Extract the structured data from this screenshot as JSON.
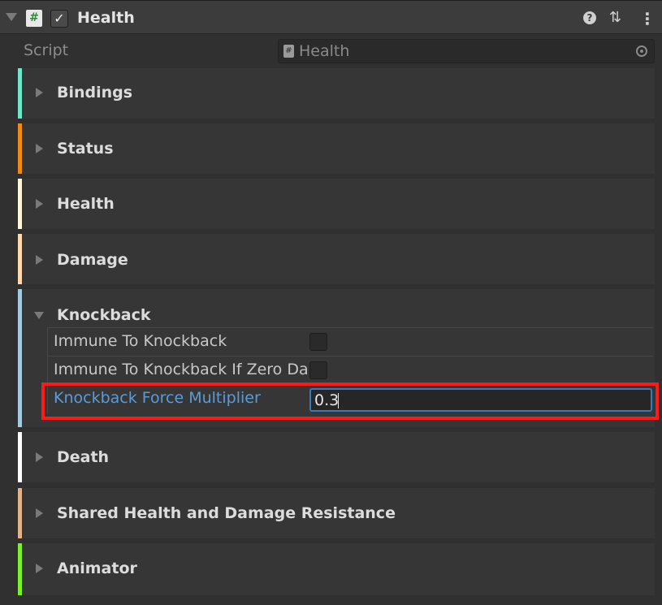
{
  "component": {
    "title": "Health",
    "script_icon_glyph": "#",
    "enabled": true
  },
  "script_row": {
    "label": "Script",
    "value": "Health"
  },
  "sections": [
    {
      "title": "Bindings",
      "color": "#6fe6c8",
      "expanded": false
    },
    {
      "title": "Status",
      "color": "#f08a12",
      "expanded": false
    },
    {
      "title": "Health",
      "color": "#fff6dc",
      "expanded": false
    },
    {
      "title": "Damage",
      "color": "#ffd9b0",
      "expanded": false
    },
    {
      "title": "Knockback",
      "color": "#a6cbe0",
      "expanded": true
    },
    {
      "title": "Death",
      "color": "#ffffff",
      "expanded": false
    },
    {
      "title": "Shared Health and Damage Resistance",
      "color": "#e2b48c",
      "expanded": false
    },
    {
      "title": "Animator",
      "color": "#7cf02a",
      "expanded": false
    }
  ],
  "knockback_props": {
    "immune_label": "Immune To Knockback",
    "immune_value": false,
    "immune_zero_label": "Immune To Knockback If Zero Damage",
    "immune_zero_value": false,
    "force_label": "Knockback Force Multiplier",
    "force_value": "0.3"
  },
  "colors": {
    "accent_label": "#5b9bd9",
    "focus_border": "#3a79bb",
    "highlight_box": "#ff1a1a"
  },
  "icons": {
    "foldout": "triangle-down",
    "help": "question-circle",
    "preset": "sliders",
    "menu": "kebab-vertical",
    "object_picker": "target-circle"
  }
}
